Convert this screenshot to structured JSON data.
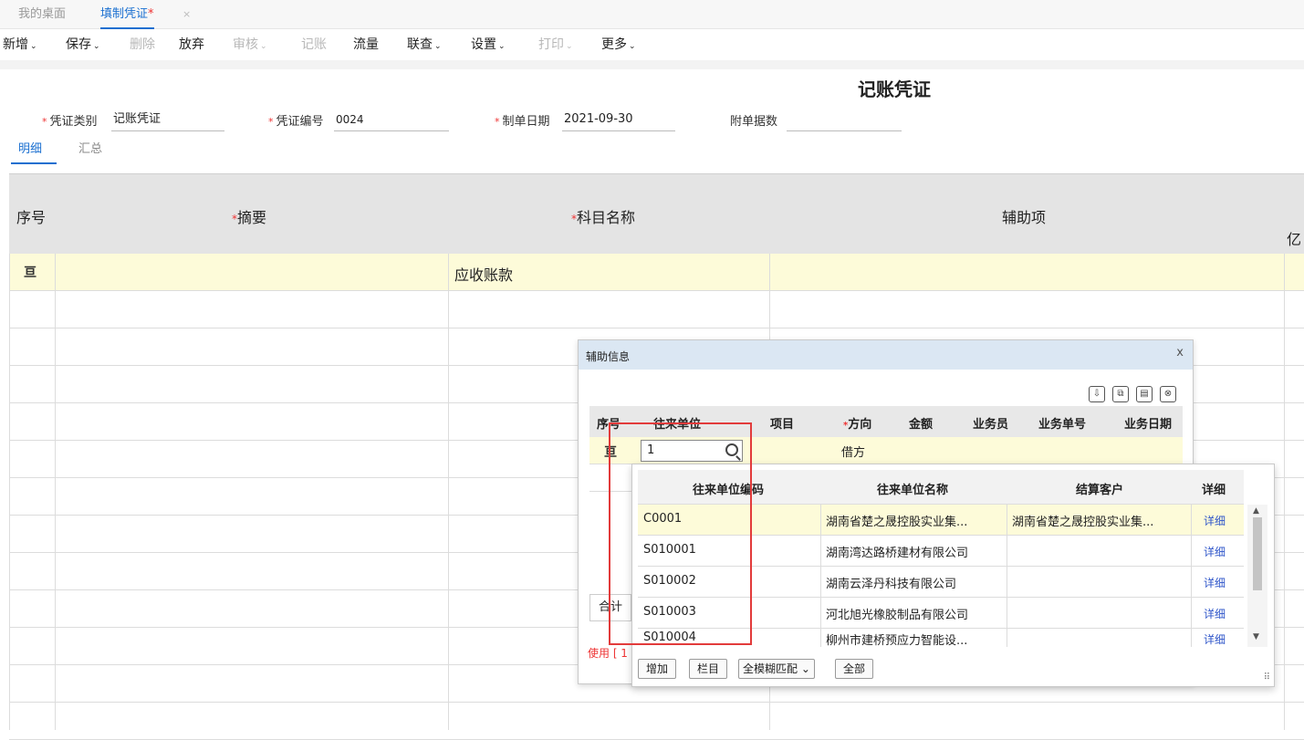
{
  "tabs": [
    {
      "label": "我的桌面"
    },
    {
      "label": "填制凭证",
      "modified": "*"
    }
  ],
  "tab_close": "×",
  "toolbar": [
    {
      "label": "新增",
      "caret": "⌄",
      "disabled": false
    },
    {
      "label": "保存",
      "caret": "⌄",
      "disabled": false
    },
    {
      "label": "删除",
      "caret": "",
      "disabled": true
    },
    {
      "label": "放弃",
      "caret": "",
      "disabled": false
    },
    {
      "label": "审核",
      "caret": "⌄",
      "disabled": true
    },
    {
      "label": "记账",
      "caret": "",
      "disabled": true
    },
    {
      "label": "流量",
      "caret": "",
      "disabled": false
    },
    {
      "label": "联查",
      "caret": "⌄",
      "disabled": false
    },
    {
      "label": "设置",
      "caret": "⌄",
      "disabled": false
    },
    {
      "label": "打印",
      "caret": "⌄",
      "disabled": true
    },
    {
      "label": "更多",
      "caret": "⌄",
      "disabled": false
    }
  ],
  "doc_title": "记账凭证",
  "fields": {
    "voucher_type_label": "凭证类别",
    "voucher_type_value": "记账凭证",
    "voucher_no_label": "凭证编号",
    "voucher_no_value": "0024",
    "date_label": "制单日期",
    "date_value": "2021-09-30",
    "attachments_label": "附单据数",
    "attachments_value": "",
    "required_mark": "*"
  },
  "subtabs": [
    "明细",
    "汇总"
  ],
  "grid": {
    "headers": {
      "seq": "序号",
      "summary": "摘要",
      "account": "科目名称",
      "aux": "辅助项",
      "amount_unit": "亿"
    },
    "row_icon": "亘",
    "first_row_account": "应收账款"
  },
  "dialog": {
    "title": "辅助信息",
    "close": "x",
    "icons": [
      "export-icon",
      "copy-icon",
      "paste-icon",
      "delete-icon"
    ],
    "headers": [
      "序号",
      "往来单位",
      "项目",
      "方向",
      "金额",
      "业务员",
      "业务单号",
      "业务日期"
    ],
    "row_icon": "亘",
    "search_value": "1",
    "direction_value": "借方",
    "sum_label": "合计",
    "use_text": "使用 [ 1"
  },
  "dropdown": {
    "headers": [
      "往来单位编码",
      "往来单位名称",
      "结算客户",
      "详细"
    ],
    "rows": [
      {
        "code": "C0001",
        "name": "湖南省楚之晟控股实业集...",
        "customer": "湖南省楚之晟控股实业集...",
        "detail": "详细"
      },
      {
        "code": "S010001",
        "name": "湖南湾达路桥建材有限公司",
        "customer": "",
        "detail": "详细"
      },
      {
        "code": "S010002",
        "name": "湖南云泽丹科技有限公司",
        "customer": "",
        "detail": "详细"
      },
      {
        "code": "S010003",
        "name": "河北旭光橡胶制品有限公司",
        "customer": "",
        "detail": "详细"
      },
      {
        "code": "S010004",
        "name": "柳州市建桥预应力智能设...",
        "customer": "",
        "detail": "详细"
      }
    ],
    "footer": {
      "add": "增加",
      "columns": "栏目",
      "match_mode": "全模糊匹配",
      "match_caret": "⌄",
      "all": "全部"
    },
    "scroll_up": "▲",
    "scroll_down": "▼",
    "grip": "⠿"
  },
  "colors": {
    "accent": "#1a6fd0",
    "highlight_row": "#fdfbd9",
    "annotation": "#e23b3b",
    "link": "#2e55c9"
  }
}
